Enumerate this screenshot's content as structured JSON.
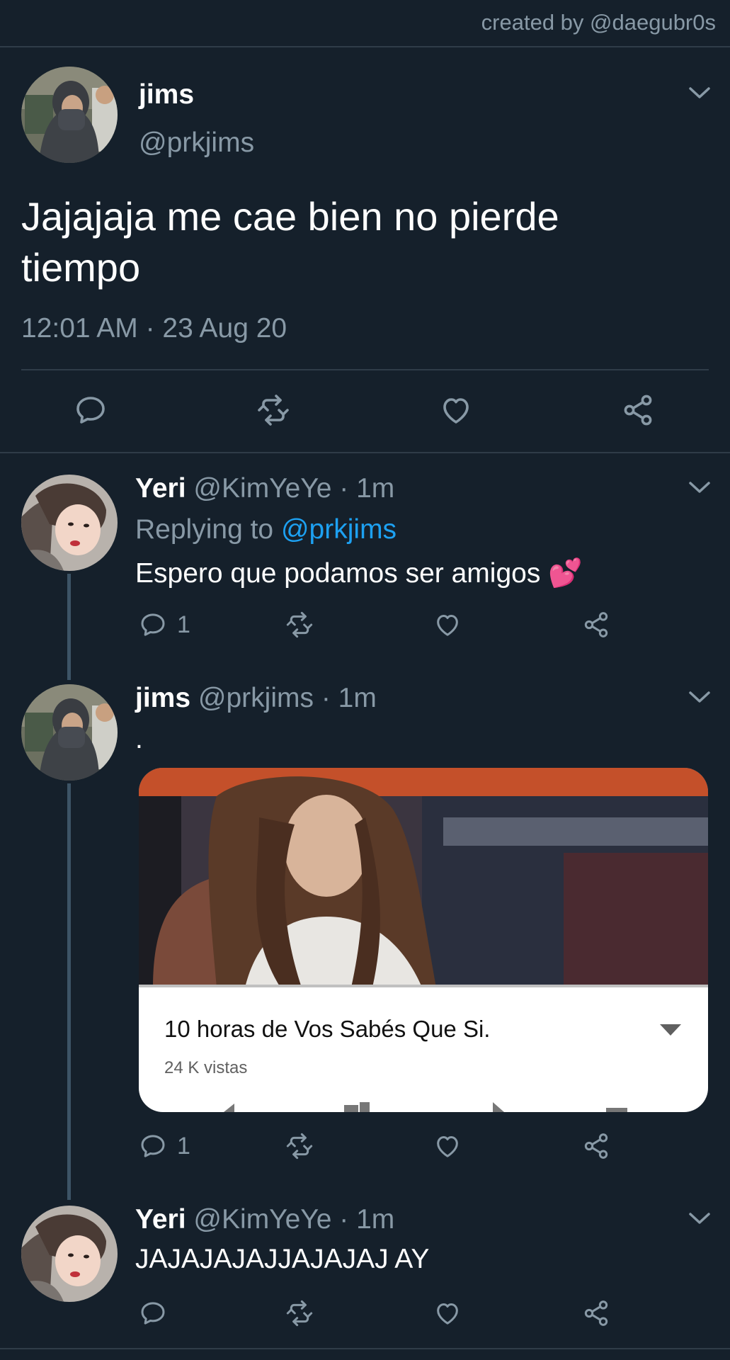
{
  "header": {
    "credit": "created by @daegubr0s"
  },
  "main_tweet": {
    "name": "jims",
    "handle": "@prkjims",
    "text": "Jajajaja me cae bien no pierde tiempo",
    "timestamp": "12:01 AM · 23 Aug 20",
    "actions": [
      "reply-icon",
      "retweet-icon",
      "like-icon",
      "share-icon"
    ]
  },
  "replies": [
    {
      "name": "Yeri",
      "handle": "@KimYeYe",
      "time": "· 1m",
      "replying_prefix": "Replying to",
      "replying_handle": "@prkjims",
      "text": "Espero que podamos ser amigos",
      "emoji": "💕",
      "reply_count": "1"
    },
    {
      "name": "jims",
      "handle": "@prkjims",
      "time": "· 1m",
      "text": ".",
      "card": {
        "title": "10 horas de Vos Sabés Que Si.",
        "views": "24 K vistas"
      },
      "reply_count": "1"
    },
    {
      "name": "Yeri",
      "handle": "@KimYeYe",
      "time": "· 1m",
      "text": "JAJAJAJAJJAJAJAJ AY",
      "reply_count": ""
    }
  ],
  "colors": {
    "background": "#15202b",
    "muted": "#8899a6",
    "link": "#1da1f2",
    "divider": "#2f3c48"
  }
}
